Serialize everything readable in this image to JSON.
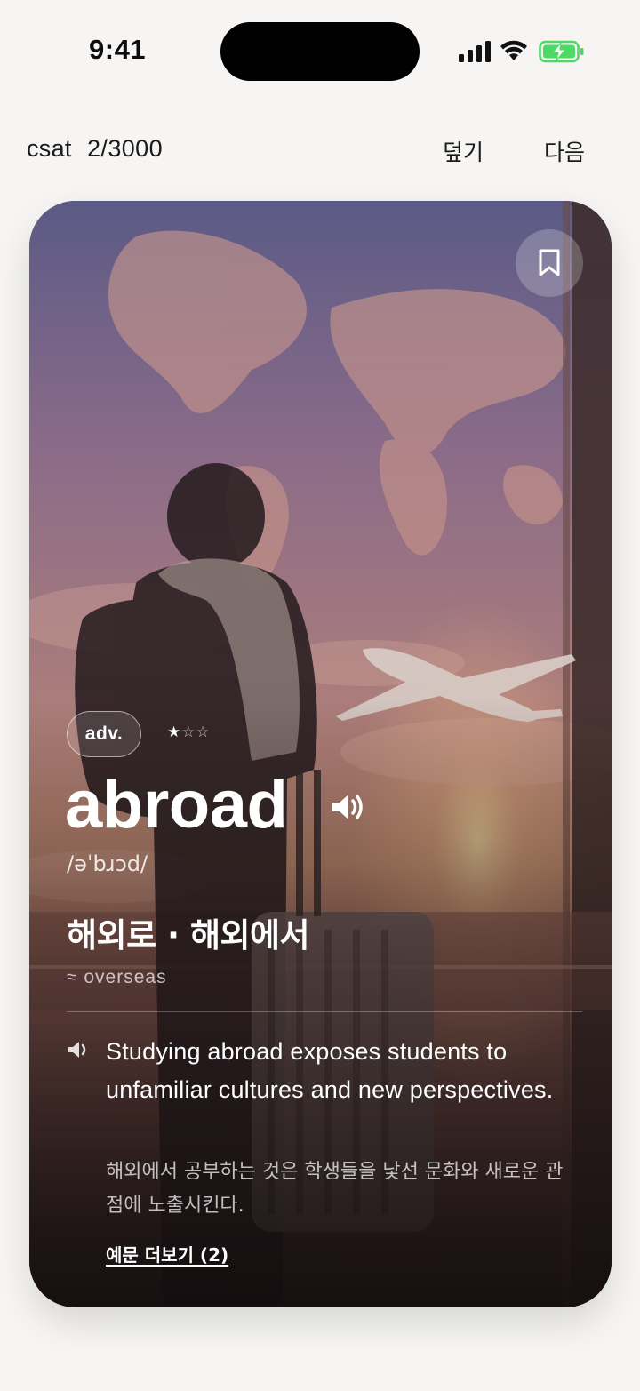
{
  "status_bar": {
    "time": "9:41",
    "icons": [
      "cellular-signal-icon",
      "wifi-icon",
      "battery-charging-icon"
    ],
    "battery_color": "#4cd964"
  },
  "header": {
    "deck": "csat",
    "progress": "2/3000",
    "cover_label": "덮기",
    "next_label": "다음"
  },
  "card": {
    "bookmark_icon": "bookmark-icon",
    "part_of_speech": "adv.",
    "difficulty": {
      "rating": 1,
      "max": 5
    },
    "stars_filled": "★",
    "stars_empty": "☆☆",
    "word": "abroad",
    "pronunciation": "/əˈbɹɔd/",
    "meaning_ko": "해외로 · 해외에서",
    "synonym": "≈ overseas",
    "example": {
      "en": "Studying abroad exposes students to unfamiliar cultures and new perspectives.",
      "ko": "해외에서 공부하는 것은 학생들을 낯선 문화와 새로운 관점에 노출시킨다."
    },
    "more_examples_label": "예문 더보기 (2)"
  }
}
